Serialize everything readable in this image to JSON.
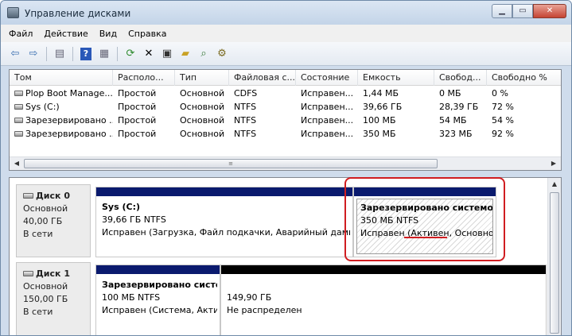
{
  "window": {
    "title": "Управление дисками"
  },
  "menu": [
    "Файл",
    "Действие",
    "Вид",
    "Справка"
  ],
  "toolbar_icons": [
    "back-icon",
    "forward-icon",
    "panel-icon",
    "help-icon",
    "panel2-icon",
    "refresh-icon",
    "delete-icon",
    "properties-icon",
    "open-folder-icon",
    "search-icon",
    "settings-icon"
  ],
  "volumes": {
    "columns": [
      "Том",
      "Располо...",
      "Тип",
      "Файловая с...",
      "Состояние",
      "Емкость",
      "Свобод...",
      "Свободно %"
    ],
    "rows": [
      [
        "Plop Boot Manage...",
        "Простой",
        "Основной",
        "CDFS",
        "Исправен...",
        "1,44 МБ",
        "0 МБ",
        "0 %"
      ],
      [
        "Sys (C:)",
        "Простой",
        "Основной",
        "NTFS",
        "Исправен...",
        "39,66 ГБ",
        "28,39 ГБ",
        "72 %"
      ],
      [
        "Зарезервировано ...",
        "Простой",
        "Основной",
        "NTFS",
        "Исправен...",
        "100 МБ",
        "54 МБ",
        "54 %"
      ],
      [
        "Зарезервировано ...",
        "Простой",
        "Основной",
        "NTFS",
        "Исправен...",
        "350 МБ",
        "323 МБ",
        "92 %"
      ]
    ]
  },
  "disks": [
    {
      "name": "Диск 0",
      "type": "Основной",
      "size": "40,00 ГБ",
      "status": "В сети",
      "partitions": [
        {
          "label": "Sys  (C:)",
          "size": "39,66 ГБ NTFS",
          "status": "Исправен (Загрузка, Файл подкачки, Аварийный дамп п"
        },
        {
          "label": "Зарезервировано системой",
          "size": "350 МБ NTFS",
          "status": "Исправен (Активен, Основной"
        }
      ]
    },
    {
      "name": "Диск 1",
      "type": "Основной",
      "size": "150,00 ГБ",
      "status": "В сети",
      "partitions": [
        {
          "label": "Зарезервировано систе",
          "size": "100 МБ NTFS",
          "status": "Исправен (Система, Акти"
        },
        {
          "label": "",
          "size": "149,90 ГБ",
          "status": "Не распределен"
        }
      ]
    }
  ]
}
